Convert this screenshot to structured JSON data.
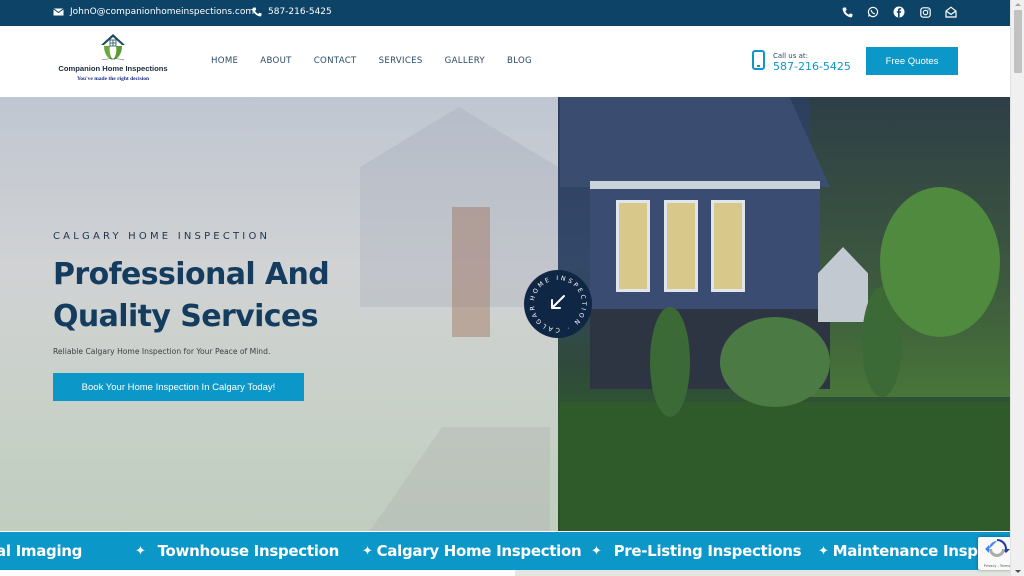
{
  "topbar": {
    "email": "JohnO@companionhomeinspections.com",
    "phone": "587-216-5425",
    "socials": [
      {
        "icon": "phone-icon"
      },
      {
        "icon": "whatsapp-icon"
      },
      {
        "icon": "facebook-icon"
      },
      {
        "icon": "instagram-icon"
      },
      {
        "icon": "envelope-open-icon"
      }
    ]
  },
  "header": {
    "logo": {
      "name": "Companion Home Inspections",
      "tagline": "You've made the right decision"
    },
    "nav": [
      "HOME",
      "ABOUT",
      "CONTACT",
      "SERVICES",
      "GALLERY",
      "BLOG"
    ],
    "call": {
      "label": "Call us at:",
      "number": "587-216-5425"
    },
    "cta_label": "Free Quotes"
  },
  "hero": {
    "eyebrow": "CALGARY HOME INSPECTION",
    "headline_line1": "Professional And",
    "headline_line2": "Quality Services",
    "subtext": "Reliable Calgary Home Inspection for Your Peace of Mind.",
    "button_label": "Book Your Home Inspection In Calgary Today!",
    "badge_text": "HOME INSPECTION · CALGARY ·"
  },
  "marquee": {
    "items": [
      "al Imaging",
      "Townhouse Inspection",
      "Calgary Home Inspection",
      "Pre-Listing Inspections",
      "Maintenance Inspec"
    ]
  },
  "recaptcha": {
    "terms": "Privacy - Terms"
  },
  "colors": {
    "topbar": "#0d4366",
    "accent": "#0c97c9",
    "heading": "#143c5e",
    "badge": "#0f2744"
  }
}
